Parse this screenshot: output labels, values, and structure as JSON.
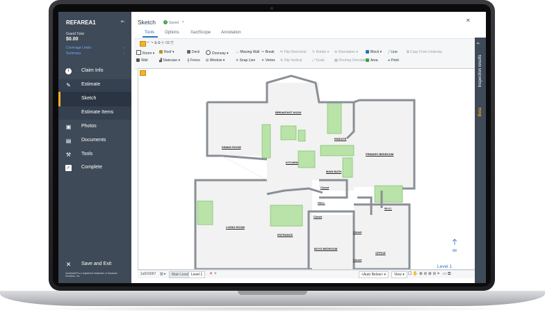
{
  "app": {
    "claim_id": "REFAREA1",
    "grand_total_label": "Grand Total",
    "grand_total_value": "$0.00",
    "coverage_link": "Coverage Limits",
    "summary_link": "Summary",
    "trademark": "Xactimate® is a registered trademark of Xactware Solutions, Inc."
  },
  "sidebar": {
    "items": [
      {
        "label": "Claim Info",
        "icon": "info-icon"
      },
      {
        "label": "Estimate",
        "icon": "hammer-icon"
      },
      {
        "label": "Sketch",
        "icon": ""
      },
      {
        "label": "Estimate Items",
        "icon": ""
      },
      {
        "label": "Photos",
        "icon": "photo-icon"
      },
      {
        "label": "Documents",
        "icon": "documents-icon"
      },
      {
        "label": "Tools",
        "icon": "wrench-icon"
      },
      {
        "label": "Complete",
        "icon": "check-icon"
      }
    ],
    "save_exit": "Save and Exit"
  },
  "header": {
    "title": "Sketch",
    "status": "Saved",
    "tabs": [
      "Tools",
      "Options",
      "XactScope",
      "Annotation"
    ]
  },
  "toolbar": {
    "row1": [
      "Room",
      "Roof",
      "Deck",
      "Doorway",
      "Missing Wall",
      "Break",
      "Flip Horizontal",
      "Rotate",
      "Orientation",
      "Block",
      "Line",
      "Copy From Underlay"
    ],
    "row2": [
      "Wall",
      "Staircase",
      "Fence",
      "Window",
      "Snap Line",
      "Vertex",
      "Flip Vertical",
      "Scale",
      "Flooring Orientation",
      "Area",
      "Point"
    ]
  },
  "rooms": {
    "breakfast": "BREAKFAST NOOK",
    "dining": "DINING ROOM",
    "kitchen": "KITCHEN",
    "ensuite": "ENSUITE",
    "primary_bedroom": "PRIMARY BEDROOM",
    "main_bath": "MAIN BATH",
    "closet1": "Closet",
    "hall": "HALL",
    "closet2": "Closet",
    "wic": "W.I.C.",
    "living": "LIVING ROOM",
    "entrance": "ENTRANCE",
    "closet3": "Closet",
    "boys_bedroom": "BOYS BEDROOM",
    "office": "OFFICE",
    "closet4": "Closet"
  },
  "bottom": {
    "sheet_id": "1a916097",
    "main_level": "Main Level",
    "level_tab": "Level 1",
    "auto_below": "<Auto Below>",
    "view": "View",
    "level_indicator": "Level 1"
  },
  "right_panel": {
    "inspection": "Inspection results",
    "beta": "Beta"
  },
  "colors": {
    "sidebar_bg": "#3f4a58",
    "accent_blue": "#2a6ebb",
    "green_fixture": "#b9e3a8",
    "link_blue": "#6fa8ff",
    "beta_orange": "#f0a020"
  }
}
